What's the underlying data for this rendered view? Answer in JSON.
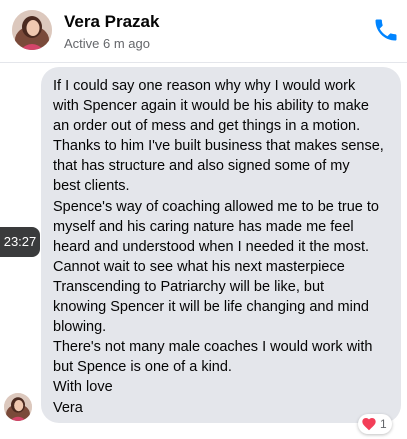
{
  "header": {
    "name": "Vera Prazak",
    "status": "Active 6 m ago"
  },
  "message": {
    "time": "23:27",
    "lines": [
      "If I could say one reason why why I would work",
      "with Spencer again it would be his ability to make",
      "an order out of mess and get things in a motion.",
      "Thanks to him I've built business that makes sense,",
      "that has structure and also signed some of my",
      "best clients.",
      "Spence's way of coaching allowed me to be true to",
      "myself and his caring nature has made me feel",
      "heard and understood when I needed it the most.",
      "Cannot wait to see what his next masterpiece",
      "Transcending to Patriarchy will be like, but",
      "knowing Spencer it will be life changing and mind",
      "blowing.",
      "There's not many male coaches I would work with",
      "but Spence is one of a kind.",
      "With love",
      "Vera"
    ],
    "reaction": {
      "icon": "heart-icon",
      "count": "1"
    }
  },
  "colors": {
    "bubble": "#e4e6eb",
    "accent": "#0084ff",
    "heart": "#f33e58"
  }
}
